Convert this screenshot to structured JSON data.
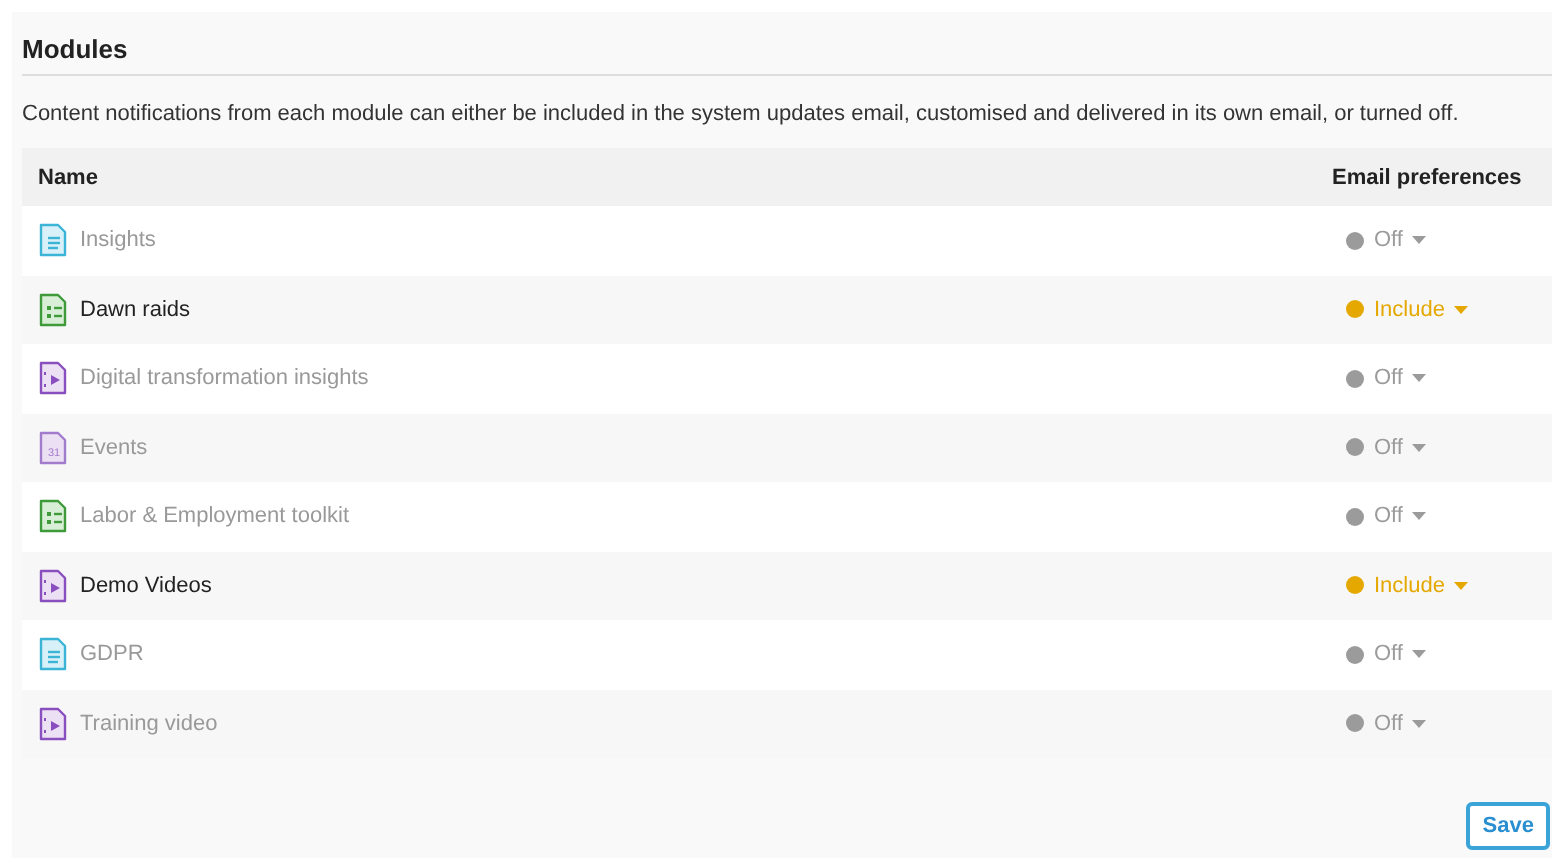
{
  "title": "Modules",
  "description": "Content notifications from each module can either be included in the system updates email, customised and delivered in its own email, or turned off.",
  "table": {
    "columns": [
      "Name",
      "Email preferences"
    ],
    "rows": [
      {
        "name": "Insights",
        "icon": {
          "kind": "document"
        },
        "active": false,
        "preference": "Off",
        "color": "#9b9b9b"
      },
      {
        "name": "Dawn raids",
        "icon": {
          "kind": "list"
        },
        "active": true,
        "preference": "Include",
        "color": "#e5a800"
      },
      {
        "name": "Digital transformation insights",
        "icon": {
          "kind": "video"
        },
        "active": false,
        "preference": "Off",
        "color": "#9b9b9b"
      },
      {
        "name": "Events",
        "icon": {
          "kind": "calendar",
          "label": "31"
        },
        "active": false,
        "preference": "Off",
        "color": "#9b9b9b"
      },
      {
        "name": "Labor & Employment toolkit",
        "icon": {
          "kind": "list"
        },
        "active": false,
        "preference": "Off",
        "color": "#9b9b9b"
      },
      {
        "name": "Demo Videos",
        "icon": {
          "kind": "video"
        },
        "active": true,
        "preference": "Include",
        "color": "#e5a800"
      },
      {
        "name": "GDPR",
        "icon": {
          "kind": "document"
        },
        "active": false,
        "preference": "Off",
        "color": "#9b9b9b"
      },
      {
        "name": "Training video",
        "icon": {
          "kind": "video"
        },
        "active": false,
        "preference": "Off",
        "color": "#9b9b9b"
      }
    ]
  },
  "save_button": "Save"
}
